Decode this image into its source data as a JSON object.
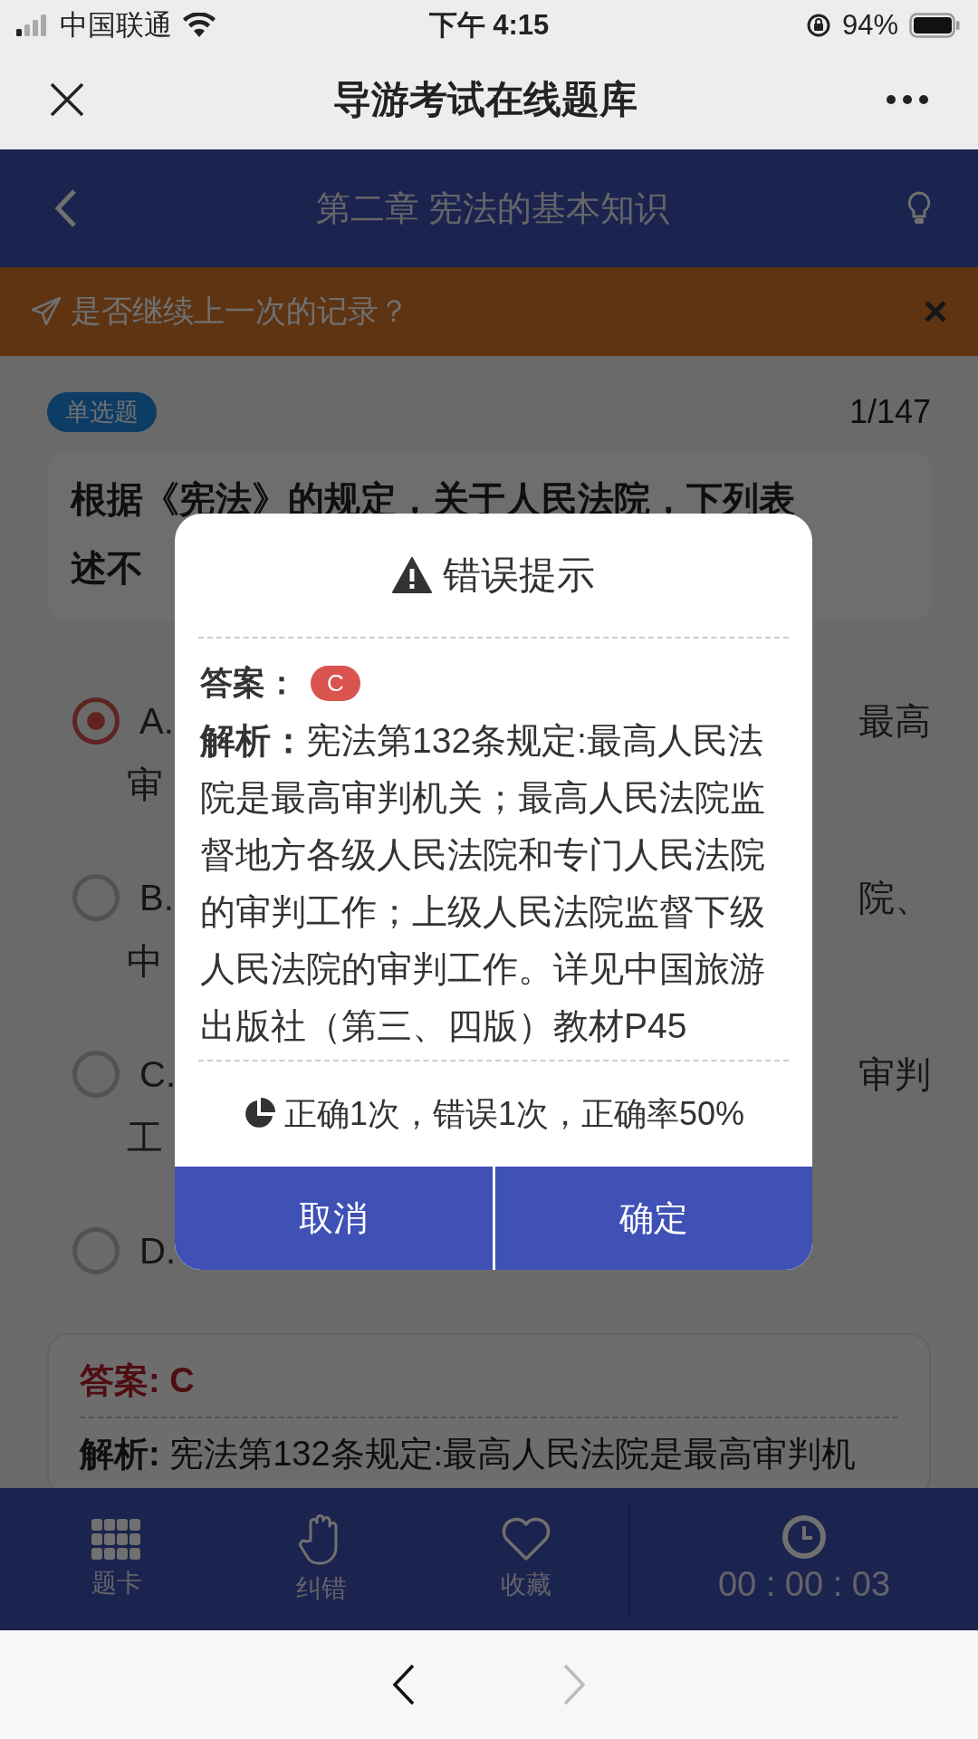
{
  "status_bar": {
    "carrier": "中国联通",
    "time": "下午 4:15",
    "battery": "94%"
  },
  "app_bar": {
    "title": "导游考试在线题库"
  },
  "chapter_header": {
    "title": "第二章 宪法的基本知识"
  },
  "resume_banner": {
    "text": "是否继续上一次的记录？"
  },
  "question": {
    "type_tag": "单选题",
    "counter": "1/147",
    "lines": [
      "根据《宪法》的规定，关于人民法院，下列表",
      "述不"
    ]
  },
  "options": [
    {
      "letter": "A.",
      "selected": true,
      "tail": "最高",
      "line2": "审"
    },
    {
      "letter": "B.",
      "selected": false,
      "tail": "院、",
      "line2": "中"
    },
    {
      "letter": "C.",
      "selected": false,
      "tail": "审判",
      "line2": "工"
    },
    {
      "letter": "D.",
      "selected": false
    }
  ],
  "answer_card": {
    "answer": "答案: C",
    "analysis": "**解析:** 宪法第132条规定:最高人民法院是最高审判机"
  },
  "bottom_bar": {
    "items": [
      {
        "label": "题卡"
      },
      {
        "label": "纠错"
      },
      {
        "label": "收藏"
      }
    ],
    "timer": "00 : 00 : 03"
  },
  "dialog": {
    "title": "错误提示",
    "answer_label": "答案：",
    "answer": "C",
    "analysis": "**解析：**宪法第132条规定:最高人民法院是最高审判机关；最高人民法院监督地方各级人民法院和专门人民法院的审判工作；上级人民法院监督下级人民法院的审判工作。详见中国旅游出版社（第三、四版）教材P45",
    "stats": "正确1次，错误1次，正确率50%",
    "buttons": [
      "取消",
      "确定"
    ]
  },
  "browser_nav": {
    "back_disabled": false,
    "forward_disabled": true
  }
}
